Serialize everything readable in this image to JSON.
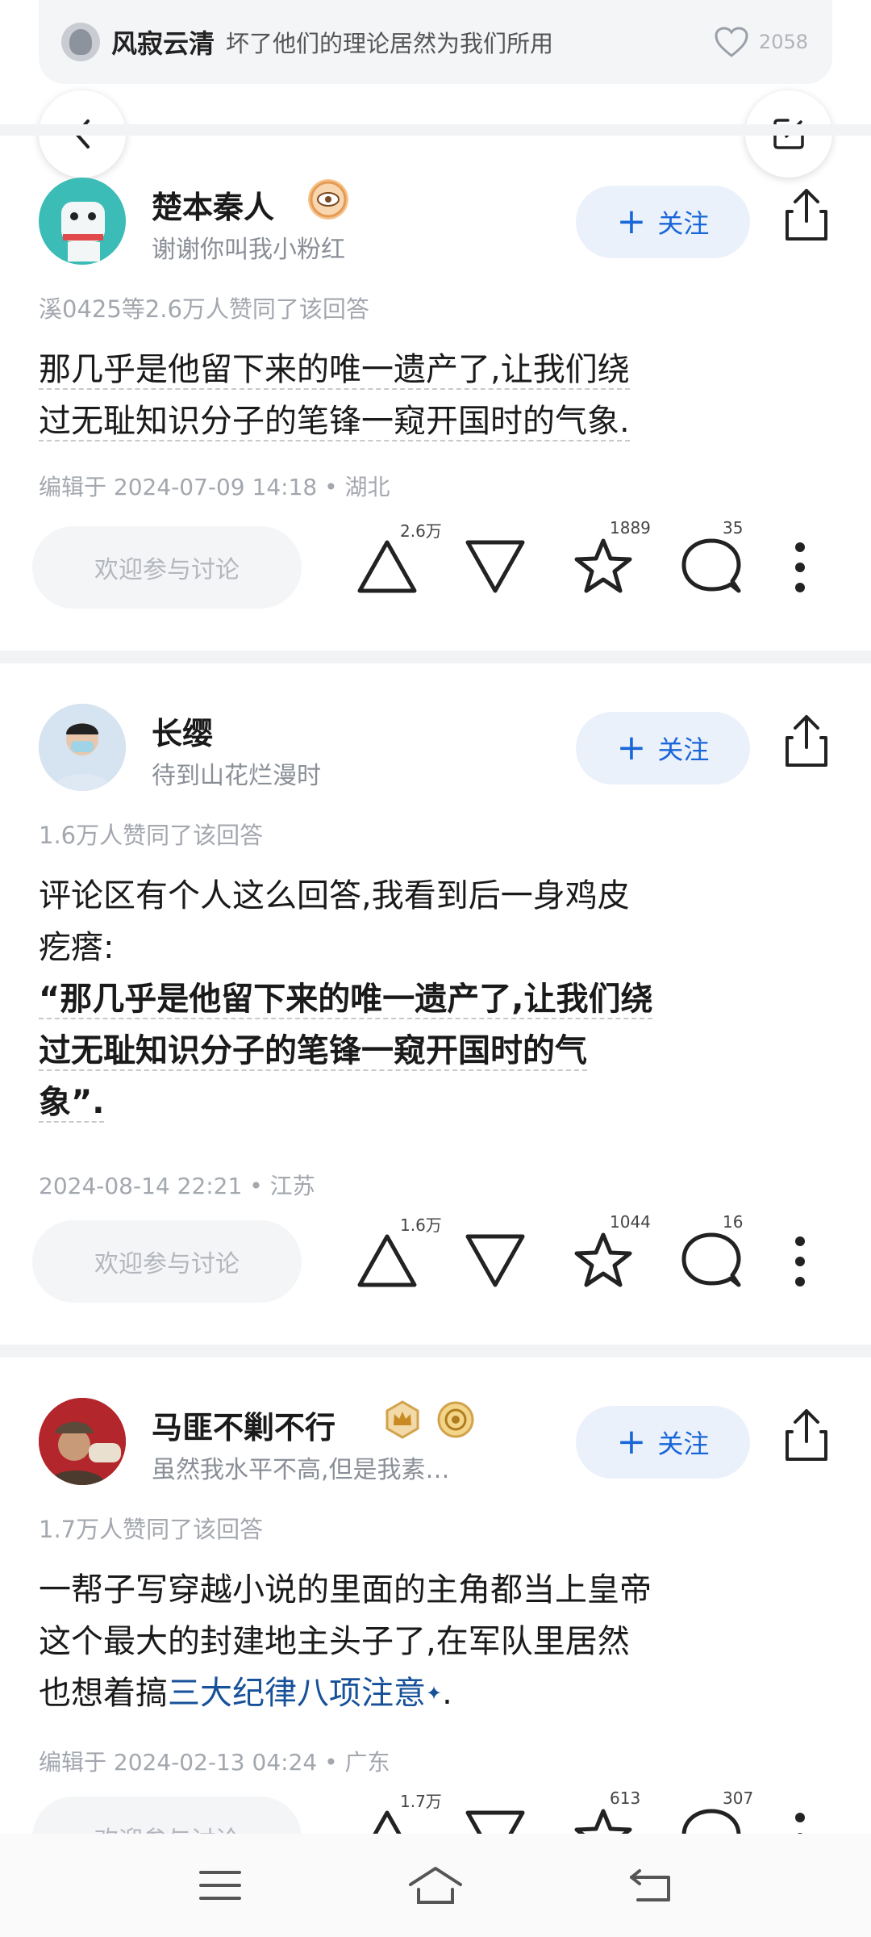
{
  "top_comment": {
    "name": "风寂云清",
    "text": "坏了他们的理论居然为我们所用",
    "likes": "2058"
  },
  "answers": [
    {
      "author": "楚本秦人",
      "bio": "谢谢你叫我小粉红",
      "follow_label": "关注",
      "agree_text": "溪0425等2.6万人赞同了该回答",
      "content_lines": [
        "那几乎是他留下来的唯一遗产了,让我们绕",
        "过无耻知识分子的笔锋一窥开国时的气象."
      ],
      "meta": "编辑于 2024-07-09 14:18 • 湖北",
      "discuss_placeholder": "欢迎参与讨论",
      "upvotes": "2.6万",
      "favorites": "1889",
      "comments": "35"
    },
    {
      "author": "长缨",
      "bio": "待到山花烂漫时",
      "follow_label": "关注",
      "agree_text": "1.6万人赞同了该回答",
      "content_line1": "评论区有个人这么回答,我看到后一身鸡皮",
      "content_line2": "疙瘩:",
      "quote_lines": [
        "“那几乎是他留下来的唯一遗产了,让我们绕",
        "过无耻知识分子的笔锋一窥开国时的气",
        "象”."
      ],
      "meta": "2024-08-14 22:21 • 江苏",
      "discuss_placeholder": "欢迎参与讨论",
      "upvotes": "1.6万",
      "favorites": "1044",
      "comments": "16"
    },
    {
      "author": "马匪不剿不行",
      "bio": "虽然我水平不高,但是我素…",
      "follow_label": "关注",
      "agree_text": "1.7万人赞同了该回答",
      "content_line1": "一帮子写穿越小说的里面的主角都当上皇帝",
      "content_line2": "这个最大的封建地主头子了,在军队里居然",
      "content_line3_pre": "也想着搞",
      "content_line3_link": "三大纪律八项注意",
      "content_line3_post": ".",
      "meta": "编辑于 2024-02-13 04:24 • 广东",
      "discuss_placeholder": "欢迎参与讨论",
      "upvotes": "1.7万",
      "favorites": "613",
      "comments": "307"
    }
  ],
  "colors": {
    "accent": "#1966d8",
    "follow_bg": "#ebf1fb",
    "link": "#175199",
    "muted": "#a3a7ae"
  }
}
